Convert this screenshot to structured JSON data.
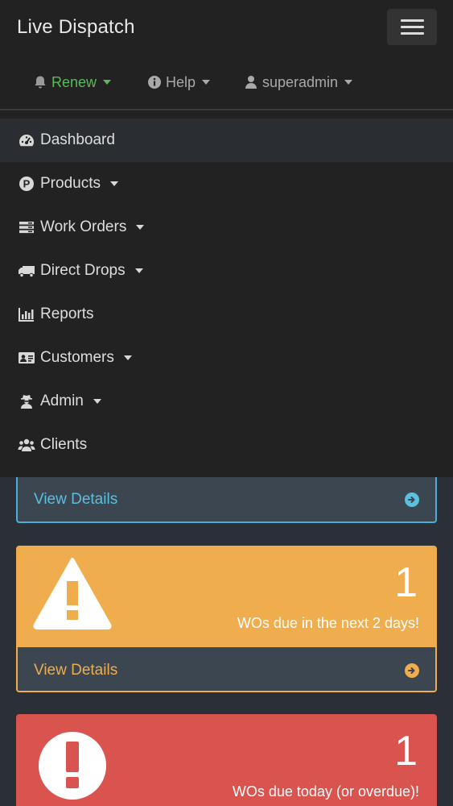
{
  "app": {
    "title": "Live Dispatch"
  },
  "topnav": {
    "renew": "Renew",
    "help": "Help",
    "user": "superadmin"
  },
  "sidebar": {
    "items": [
      {
        "label": "Dashboard",
        "icon": "dashboard-icon"
      },
      {
        "label": "Products",
        "icon": "products-icon"
      },
      {
        "label": "Work Orders",
        "icon": "work-orders-icon"
      },
      {
        "label": "Direct Drops",
        "icon": "truck-icon"
      },
      {
        "label": "Reports",
        "icon": "bar-chart-icon"
      },
      {
        "label": "Customers",
        "icon": "id-card-icon"
      },
      {
        "label": "Admin",
        "icon": "user-secret-icon"
      },
      {
        "label": "Clients",
        "icon": "users-icon"
      }
    ]
  },
  "panels": [
    {
      "details_label": "View Details",
      "color": "#5bc0de"
    },
    {
      "count": "1",
      "text": "WOs due in the next 2 days!",
      "details_label": "View Details",
      "color": "#f0ad4e",
      "icon": "warning-icon"
    },
    {
      "count": "1",
      "text": "WOs due today (or overdue)!",
      "color": "#d9534f",
      "icon": "exclamation-circle-icon"
    }
  ],
  "colors": {
    "navbar": "#222222",
    "body": "#2b3037",
    "renew": "#5cb85c"
  }
}
